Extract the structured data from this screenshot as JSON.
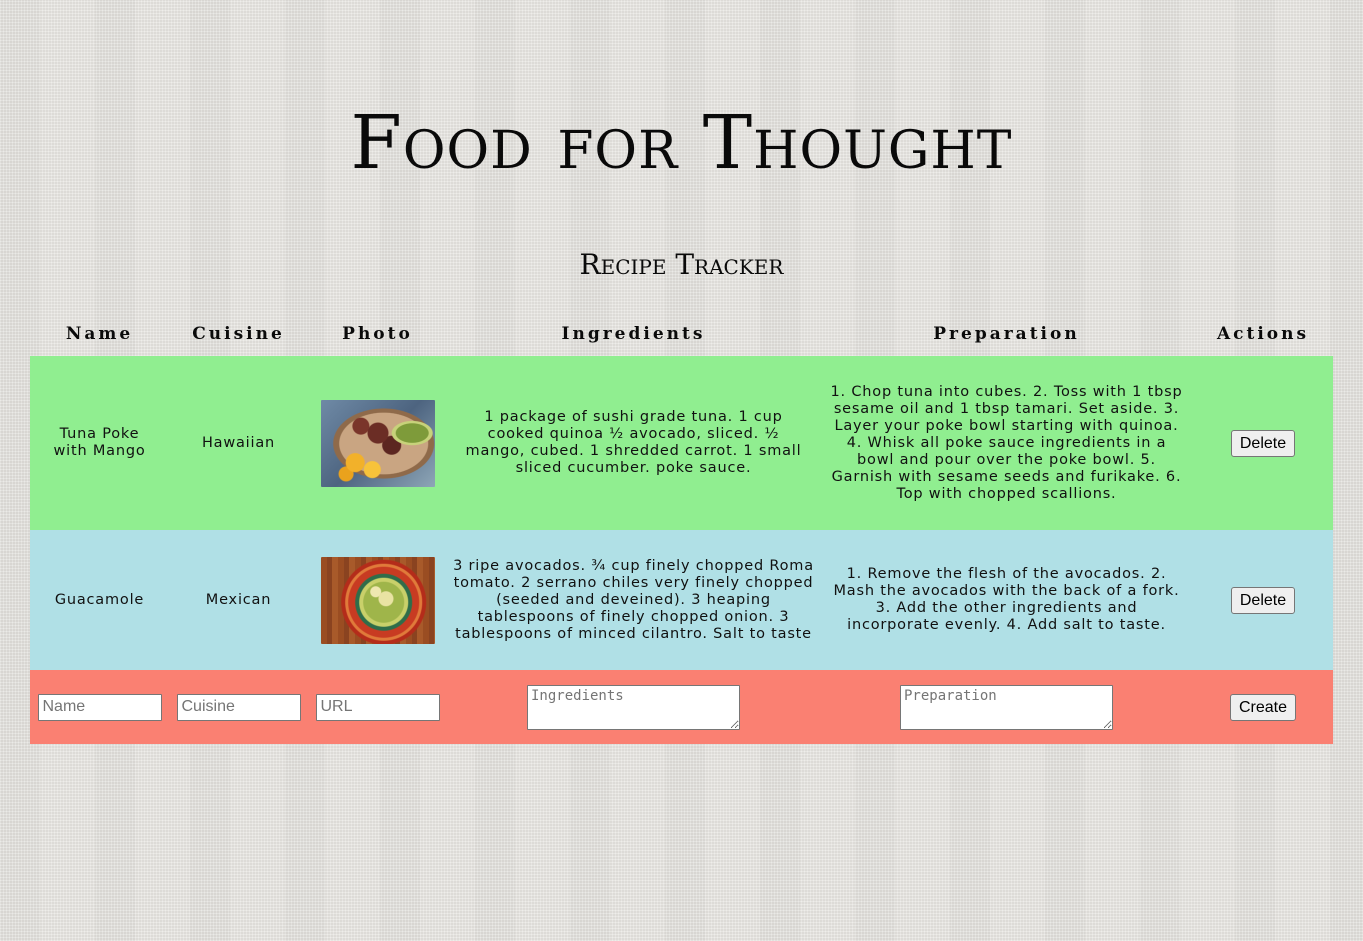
{
  "site": {
    "title": "Food for Thought",
    "subtitle": "Recipe Tracker"
  },
  "table": {
    "headers": [
      "Name",
      "Cuisine",
      "Photo",
      "Ingredients",
      "Preparation",
      "Actions"
    ],
    "rows": [
      {
        "name": "Tuna Poke with Mango",
        "cuisine": "Hawaiian",
        "photo": "tuna-poke-bowl",
        "ingredients": "1 package of sushi grade tuna. 1 cup cooked quinoa ½ avocado, sliced. ½ mango, cubed. 1 shredded carrot. 1 small sliced cucumber. poke sauce.",
        "preparation": "1. Chop tuna into cubes. 2. Toss with 1 tbsp sesame oil and 1 tbsp tamari. Set aside. 3. Layer your poke bowl starting with quinoa. 4. Whisk all poke sauce ingredients in a bowl and pour over the poke bowl. 5. Garnish with sesame seeds and furikake. 6. Top with chopped scallions.",
        "action_label": "Delete",
        "color": "#90ee90"
      },
      {
        "name": "Guacamole",
        "cuisine": "Mexican",
        "photo": "guacamole-plate",
        "ingredients": "3 ripe avocados. ¾ cup finely chopped Roma tomato. 2 serrano chiles very finely chopped (seeded and deveined). 3 heaping tablespoons of finely chopped onion. 3 tablespoons of minced cilantro. Salt to taste",
        "preparation": "1. Remove the flesh of the avocados. 2. Mash the avocados with the back of a fork. 3. Add the other ingredients and incorporate evenly. 4. Add salt to taste.",
        "action_label": "Delete",
        "color": "#b0e0e6"
      }
    ]
  },
  "form": {
    "name_placeholder": "Name",
    "cuisine_placeholder": "Cuisine",
    "url_placeholder": "URL",
    "ingredients_placeholder": "Ingredients",
    "preparation_placeholder": "Preparation",
    "create_label": "Create",
    "color": "#fa8072"
  }
}
